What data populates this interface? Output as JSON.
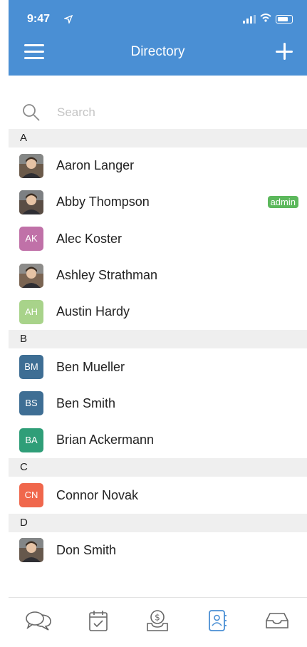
{
  "status": {
    "time": "9:47"
  },
  "header": {
    "title": "Directory"
  },
  "search": {
    "placeholder": "Search"
  },
  "colors": {
    "accent": "#4a8fd4",
    "admin_badge": "#5cb85c",
    "section_bg": "#efefef",
    "active_tab": "#4a8fd4"
  },
  "sections": [
    {
      "letter": "A",
      "contacts": [
        {
          "name": "Aaron Langer",
          "photo": true
        },
        {
          "name": "Abby Thompson",
          "photo": true,
          "badge": "admin"
        },
        {
          "name": "Alec Koster",
          "initials": "AK",
          "color": "#c071a8"
        },
        {
          "name": "Ashley Strathman",
          "photo": true
        },
        {
          "name": "Austin Hardy",
          "initials": "AH",
          "color": "#a8d38a"
        }
      ]
    },
    {
      "letter": "B",
      "contacts": [
        {
          "name": "Ben Mueller",
          "initials": "BM",
          "color": "#3e6e94"
        },
        {
          "name": "Ben Smith",
          "initials": "BS",
          "color": "#3e6e94"
        },
        {
          "name": "Brian Ackermann",
          "initials": "BA",
          "color": "#2f9e78"
        }
      ]
    },
    {
      "letter": "C",
      "contacts": [
        {
          "name": "Connor Novak",
          "initials": "CN",
          "color": "#f0674c"
        }
      ]
    },
    {
      "letter": "D",
      "contacts": [
        {
          "name": "Don Smith",
          "photo": true
        }
      ]
    }
  ],
  "tabs": [
    {
      "icon": "chat-bubbles-icon",
      "active": false
    },
    {
      "icon": "calendar-check-icon",
      "active": false
    },
    {
      "icon": "money-tray-icon",
      "active": false
    },
    {
      "icon": "contacts-book-icon",
      "active": true
    },
    {
      "icon": "inbox-tray-icon",
      "active": false
    }
  ]
}
